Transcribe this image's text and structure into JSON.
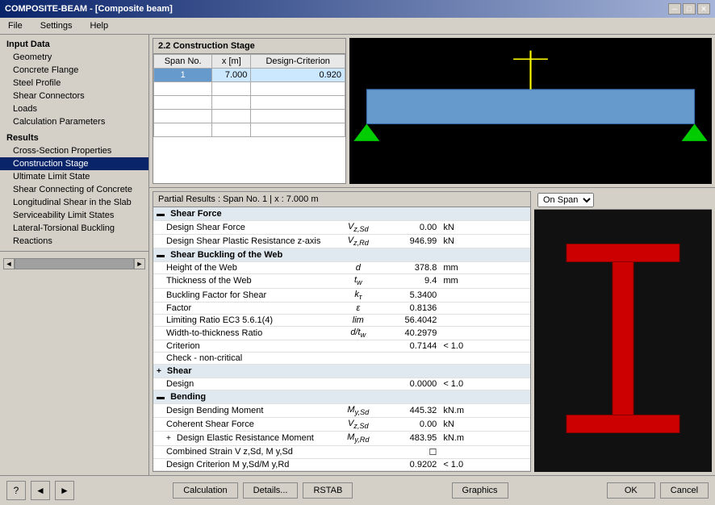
{
  "window": {
    "title": "COMPOSITE-BEAM - [Composite beam]",
    "close_label": "✕",
    "min_label": "─",
    "max_label": "□"
  },
  "menu": {
    "items": [
      "File",
      "Settings",
      "Help"
    ]
  },
  "left_panel": {
    "input_header": "Input Data",
    "input_items": [
      {
        "id": "geometry",
        "label": "Geometry"
      },
      {
        "id": "concrete-flange",
        "label": "Concrete Flange"
      },
      {
        "id": "steel-profile",
        "label": "Steel Profile"
      },
      {
        "id": "shear-connectors",
        "label": "Shear Connectors"
      },
      {
        "id": "loads",
        "label": "Loads"
      },
      {
        "id": "calc-params",
        "label": "Calculation Parameters"
      }
    ],
    "results_header": "Results",
    "results_items": [
      {
        "id": "cross-section",
        "label": "Cross-Section Properties"
      },
      {
        "id": "construction-stage",
        "label": "Construction Stage",
        "selected": true
      },
      {
        "id": "ultimate-limit",
        "label": "Ultimate Limit State"
      },
      {
        "id": "shear-connecting-concrete",
        "label": "Shear Connecting of Concrete"
      },
      {
        "id": "longitudinal-shear",
        "label": "Longitudinal Shear in the Slab"
      },
      {
        "id": "serviceability",
        "label": "Serviceability Limit States"
      },
      {
        "id": "lateral-torsional",
        "label": "Lateral-Torsional Buckling"
      },
      {
        "id": "reactions",
        "label": "Reactions"
      }
    ]
  },
  "construction_stage": {
    "title": "2.2 Construction Stage",
    "table_headers": [
      "Span No.",
      "x [m]",
      "Design-Criterion"
    ],
    "table_row": {
      "span": "1",
      "x": "7.000",
      "criterion": "0.920"
    }
  },
  "partial_results": {
    "header": "Partial Results :   Span No. 1  |  x : 7.000 m",
    "dropdown": "On Span",
    "groups": [
      {
        "id": "shear-force",
        "label": "Shear Force",
        "expanded": true,
        "rows": [
          {
            "label": "Design Shear Force",
            "symbol": "V z,Sd",
            "value": "0.00",
            "unit": "kN",
            "criterion": ""
          },
          {
            "label": "Design Shear Plastic Resistance z-axis",
            "symbol": "V z,Rd",
            "value": "946.99",
            "unit": "kN",
            "criterion": ""
          }
        ]
      },
      {
        "id": "shear-buckling",
        "label": "Shear Buckling of the Web",
        "expanded": true,
        "rows": [
          {
            "label": "Height of the Web",
            "symbol": "d",
            "value": "378.8",
            "unit": "mm",
            "criterion": ""
          },
          {
            "label": "Thickness of the Web",
            "symbol": "t w",
            "value": "9.4",
            "unit": "mm",
            "criterion": ""
          },
          {
            "label": "Buckling Factor for Shear",
            "symbol": "k τ",
            "value": "5.3400",
            "unit": "",
            "criterion": ""
          },
          {
            "label": "Factor",
            "symbol": "ε",
            "value": "0.8136",
            "unit": "",
            "criterion": ""
          },
          {
            "label": "Limiting Ratio EC3 5.6.1(4)",
            "symbol": "lim",
            "value": "56.4042",
            "unit": "",
            "criterion": ""
          },
          {
            "label": "Width-to-thickness Ratio",
            "symbol": "d/t w",
            "value": "40.2979",
            "unit": "",
            "criterion": ""
          },
          {
            "label": "Criterion",
            "symbol": "",
            "value": "0.7144",
            "unit": "< 1.0",
            "criterion": ""
          },
          {
            "label": "Check - non-critical",
            "symbol": "",
            "value": "",
            "unit": "",
            "criterion": ""
          }
        ]
      },
      {
        "id": "shear",
        "label": "Shear",
        "expanded": true,
        "rows": [
          {
            "label": "Design",
            "symbol": "",
            "value": "0.0000",
            "unit": "< 1.0",
            "criterion": ""
          }
        ]
      },
      {
        "id": "bending",
        "label": "Bending",
        "expanded": true,
        "rows": [
          {
            "label": "Design Bending Moment",
            "symbol": "M y,Sd",
            "value": "445.32",
            "unit": "kN.m",
            "criterion": ""
          },
          {
            "label": "Coherent Shear Force",
            "symbol": "V z,Sd",
            "value": "0.00",
            "unit": "kN",
            "criterion": ""
          },
          {
            "label": "Design Elastic Resistance Moment",
            "symbol": "M y,Rd",
            "value": "483.95",
            "unit": "kN.m",
            "criterion": "expand"
          },
          {
            "label": "Combined Strain V z,Sd, M y,Sd",
            "symbol": "",
            "value": "☐",
            "unit": "",
            "criterion": ""
          },
          {
            "label": "Design Criterion M y,Sd/M y,Rd",
            "symbol": "",
            "value": "0.9202",
            "unit": "< 1.0",
            "criterion": ""
          }
        ]
      }
    ]
  },
  "bottom_bar": {
    "calculation_label": "Calculation",
    "details_label": "Details...",
    "rstab_label": "RSTAB",
    "graphics_label": "Graphics",
    "ok_label": "OK",
    "cancel_label": "Cancel"
  },
  "xsection_dropdown": "On Span",
  "colors": {
    "beam_fill": "#6699cc",
    "beam_stroke": "#3366aa",
    "triangle_fill": "#00aa00",
    "line_color": "#ffff00",
    "steel_fill": "#cc0000"
  }
}
